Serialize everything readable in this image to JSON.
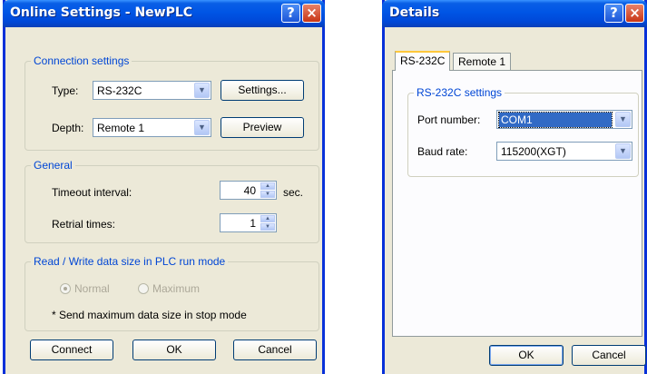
{
  "online": {
    "title": "Online Settings - NewPLC",
    "help_glyph": "?",
    "close_glyph": "×",
    "connection": {
      "legend": "Connection settings",
      "type_label": "Type:",
      "type_value": "RS-232C",
      "settings_button": "Settings...",
      "depth_label": "Depth:",
      "depth_value": "Remote 1",
      "preview_button": "Preview"
    },
    "general": {
      "legend": "General",
      "timeout_label": "Timeout interval:",
      "timeout_value": "40",
      "timeout_unit": "sec.",
      "retrial_label": "Retrial times:",
      "retrial_value": "1"
    },
    "rw": {
      "legend": "Read / Write data size in PLC run mode",
      "normal_label": "Normal",
      "maximum_label": "Maximum",
      "selected": "Normal",
      "note": "* Send maximum data size in stop mode"
    },
    "buttons": {
      "connect": "Connect",
      "ok": "OK",
      "cancel": "Cancel"
    }
  },
  "details": {
    "title": "Details",
    "help_glyph": "?",
    "close_glyph": "×",
    "tabs": [
      "RS-232C",
      "Remote 1"
    ],
    "active_tab": "RS-232C",
    "group_legend": "RS-232C settings",
    "port_label": "Port number:",
    "port_value": "COM1",
    "baud_label": "Baud rate:",
    "baud_value": "115200(XGT)",
    "buttons": {
      "ok": "OK",
      "cancel": "Cancel"
    }
  },
  "colors": {
    "title_bar": "#0054e3",
    "group_legend": "#0046d5",
    "window_face": "#ece9d8",
    "selection": "#316ac5"
  }
}
